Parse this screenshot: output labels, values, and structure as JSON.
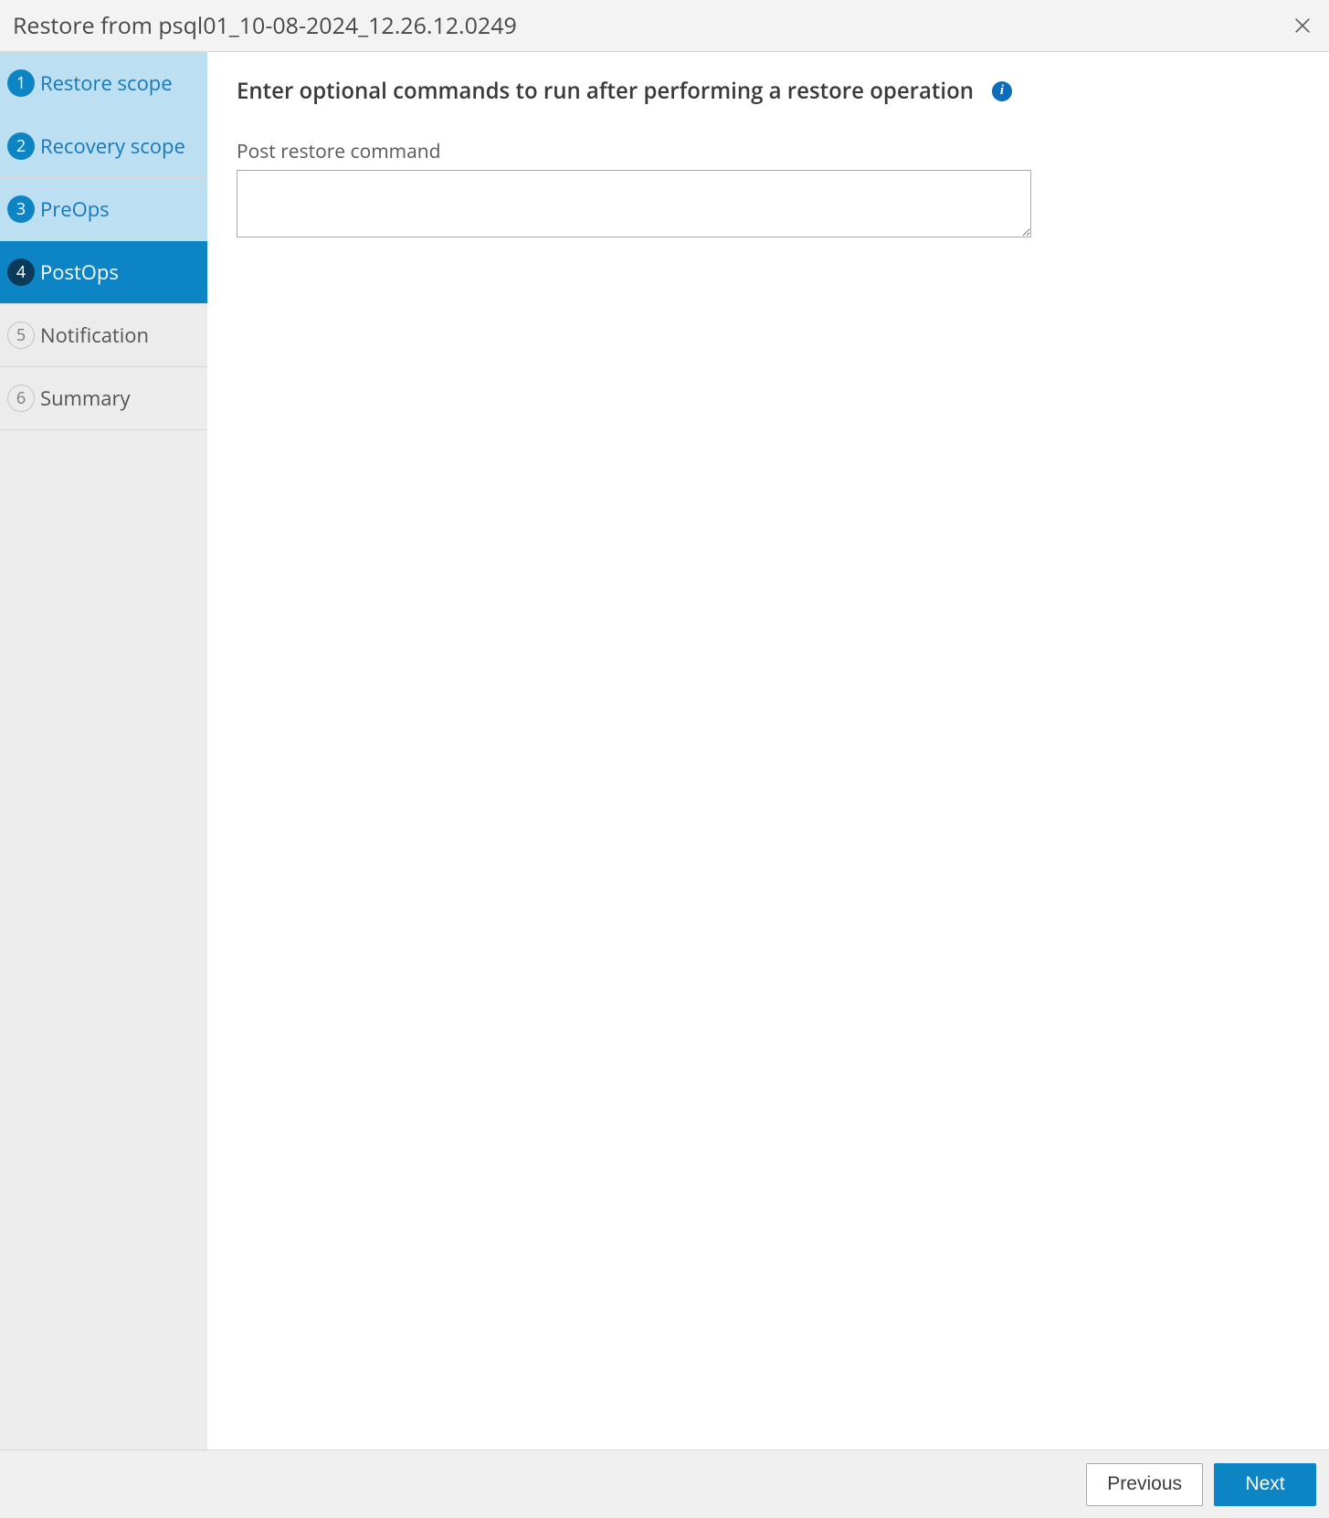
{
  "header": {
    "title": "Restore from psql01_10-08-2024_12.26.12.0249"
  },
  "sidebar": {
    "steps": [
      {
        "num": "1",
        "label": "Restore scope",
        "state": "completed"
      },
      {
        "num": "2",
        "label": "Recovery scope",
        "state": "completed"
      },
      {
        "num": "3",
        "label": "PreOps",
        "state": "completed"
      },
      {
        "num": "4",
        "label": "PostOps",
        "state": "active"
      },
      {
        "num": "5",
        "label": "Notification",
        "state": "pending"
      },
      {
        "num": "6",
        "label": "Summary",
        "state": "pending"
      }
    ]
  },
  "main": {
    "heading": "Enter optional commands to run after performing a restore operation",
    "info_glyph": "i",
    "field_label": "Post restore command",
    "command_value": ""
  },
  "footer": {
    "previous_label": "Previous",
    "next_label": "Next"
  }
}
